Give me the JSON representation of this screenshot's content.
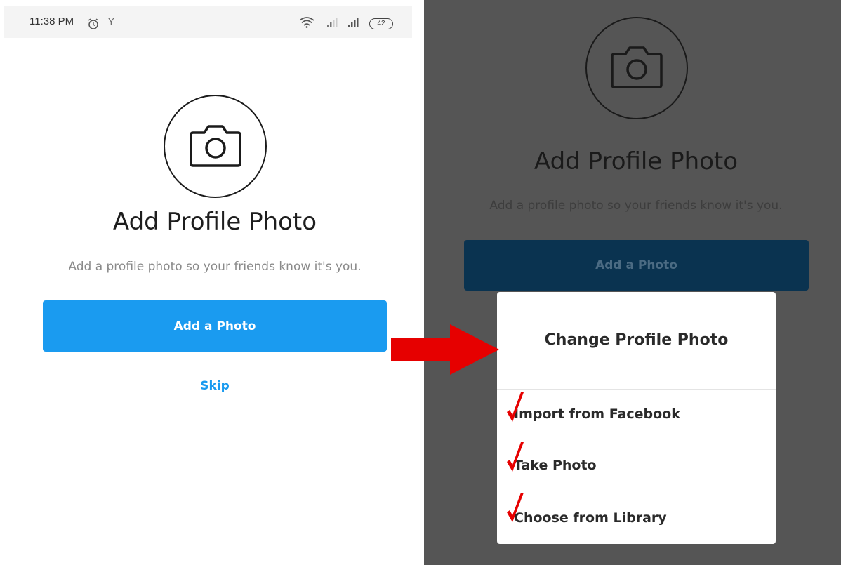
{
  "status_bar": {
    "time": "11:38 PM",
    "carrier": "Y",
    "battery": "42"
  },
  "left_screen": {
    "title": "Add Profile Photo",
    "subtitle": "Add a profile photo so your friends know it's you.",
    "add_photo_label": "Add a Photo",
    "skip_label": "Skip"
  },
  "right_screen": {
    "title": "Add Profile Photo",
    "subtitle": "Add a profile photo so your friends know it's you.",
    "add_photo_label": "Add a Photo",
    "dialog": {
      "title": "Change Profile Photo",
      "options": [
        {
          "label": "Import from Facebook"
        },
        {
          "label": "Take Photo"
        },
        {
          "label": "Choose from Library"
        }
      ]
    }
  },
  "icons": {
    "camera": "camera-icon",
    "checkmark": "checkmark-icon",
    "arrow": "red-arrow-icon"
  },
  "colors": {
    "primary_blue": "#1a9bf0",
    "overlay_gray": "#555555",
    "dim_button": "#0a3350",
    "annotation_red": "#e60000"
  }
}
